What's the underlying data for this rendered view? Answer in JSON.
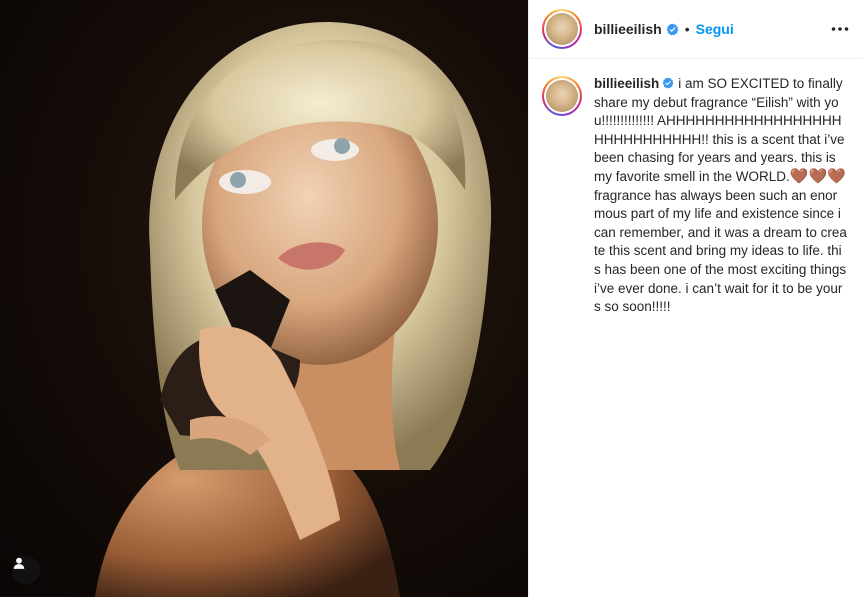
{
  "post": {
    "username": "billieeilish",
    "separator": "•",
    "follow_label": "Segui",
    "more_icon": "more-horizontal-icon",
    "verified_color": "#3897f0",
    "caption_part1": "i am SO EXCITED to finally share my debut fragrance “Eilish” with you!!!!!!!!!!!!!! AHHHHHHHHHHHHHHHHHHHHHHHHHHHHH!! this is a scent that i’ve been chasing for years and years. this is my favorite smell in the WORLD.",
    "hearts": "🤎🤎🤎",
    "caption_part2": " fragrance has always been such an enormous part of my life and existence since i can remember, and it was a dream to create this scent and bring my ideas to life. this has been one of the most exciting things i’ve ever done. i can’t wait for it to be yours so soon!!!!!",
    "tags_icon": "user-tag-icon",
    "follow_color": "#0095f6"
  }
}
